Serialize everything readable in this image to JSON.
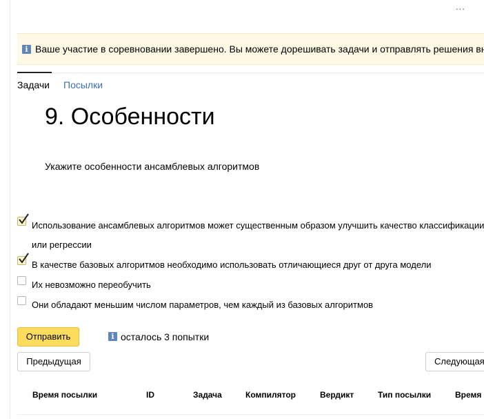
{
  "header": {
    "more_label": "..."
  },
  "notice": {
    "icon": "info-icon",
    "text": "Ваше участие в соревновании завершено. Вы можете дорешивать задачи и отправлять решения вне"
  },
  "tabs": [
    {
      "label": "Задачи",
      "active": true
    },
    {
      "label": "Посылки",
      "active": false
    }
  ],
  "task": {
    "title": "9. Особенности",
    "description": "Укажите особенности ансамблевых алгоритмов"
  },
  "options": [
    {
      "line1": "Использование ансамблевых алгоритмов может существенным образом улучшить качество классификации",
      "line2": "или регрессии",
      "checked": true
    },
    {
      "line1": "В качестве базовых алгоритмов необходимо использовать отличающиеся друг от друга модели",
      "checked": true
    },
    {
      "line1": "Их невозможно переобучить",
      "checked": false
    },
    {
      "line1": "Они обладают меньшим числом параметров, чем каждый из базовых алгоритмов",
      "checked": false
    }
  ],
  "actions": {
    "submit_label": "Отправить",
    "attempts_text": "осталось 3 попытки",
    "prev_label": "Предыдущая",
    "next_label": "Следующая"
  },
  "submissions_table": {
    "columns": [
      "Время посылки",
      "ID",
      "Задача",
      "Компилятор",
      "Вердикт",
      "Тип посылки",
      "Время"
    ]
  },
  "colors": {
    "accent": "#fddb5c",
    "link": "#3b6fb6",
    "notice_bg": "#fdf9e5",
    "info_icon": "#5f86b8"
  }
}
